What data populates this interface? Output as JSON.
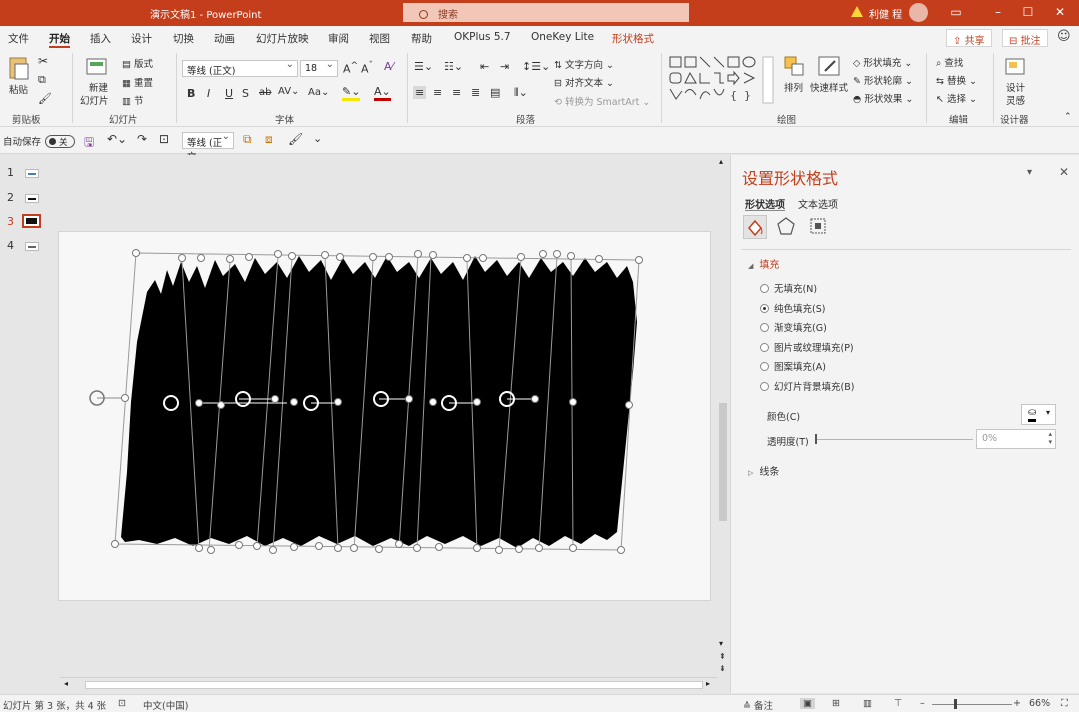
{
  "title_bar": {
    "document": "演示文稿1  -  PowerPoint",
    "search_placeholder": "搜索",
    "user": "利健 程",
    "accent": "#c43e1c"
  },
  "ribbon_tabs": [
    "文件",
    "开始",
    "插入",
    "设计",
    "切换",
    "动画",
    "幻灯片放映",
    "审阅",
    "视图",
    "帮助",
    "OKPlus 5.7",
    "OneKey Lite",
    "形状格式"
  ],
  "active_tab": "开始",
  "share_label": "共享",
  "comment_label": "批注",
  "ribbon": {
    "clipboard": {
      "paste": "粘贴",
      "group": "剪贴板"
    },
    "slides": {
      "new_slide_1": "新建",
      "new_slide_2": "幻灯片",
      "layout": "版式",
      "reset": "重置",
      "section": "节",
      "group": "幻灯片"
    },
    "font": {
      "font_name": "等线 (正文)",
      "font_size": "18",
      "group": "字体"
    },
    "paragraph": {
      "text_direction": "文字方向",
      "align_text": "对齐文本",
      "smartart": "转换为 SmartArt",
      "group": "段落"
    },
    "drawing": {
      "arrange": "排列",
      "quick_styles": "快速样式",
      "shape_fill": "形状填充",
      "shape_outline": "形状轮廓",
      "shape_effects": "形状效果",
      "group": "绘图"
    },
    "editing": {
      "find": "查找",
      "replace": "替换",
      "select": "选择",
      "group": "编辑"
    },
    "designer": {
      "design_ideas_1": "设计",
      "design_ideas_2": "灵感",
      "group": "设计器"
    }
  },
  "qat": {
    "autosave": "自动保存",
    "autosave_state": "关",
    "font": "等线 (正文"
  },
  "slide_thumbnails": [
    {
      "num": "1",
      "active": false
    },
    {
      "num": "2",
      "active": false
    },
    {
      "num": "3",
      "active": true
    },
    {
      "num": "4",
      "active": false
    }
  ],
  "format_pane": {
    "title": "设置形状格式",
    "tab_shape": "形状选项",
    "tab_text": "文本选项",
    "fill_section": "填充",
    "fill_options": [
      {
        "label": "无填充(N)",
        "selected": false
      },
      {
        "label": "纯色填充(S)",
        "selected": true
      },
      {
        "label": "渐变填充(G)",
        "selected": false
      },
      {
        "label": "图片或纹理填充(P)",
        "selected": false
      },
      {
        "label": "图案填充(A)",
        "selected": false
      },
      {
        "label": "幻灯片背景填充(B)",
        "selected": false
      }
    ],
    "color_label": "颜色(C)",
    "transparency_label": "透明度(T)",
    "transparency_value": "0%",
    "line_section": "线条"
  },
  "status": {
    "slide_info": "幻灯片 第 3 张，共 4 张",
    "language": "中文(中国)",
    "notes": "备注",
    "zoom": "66%"
  }
}
